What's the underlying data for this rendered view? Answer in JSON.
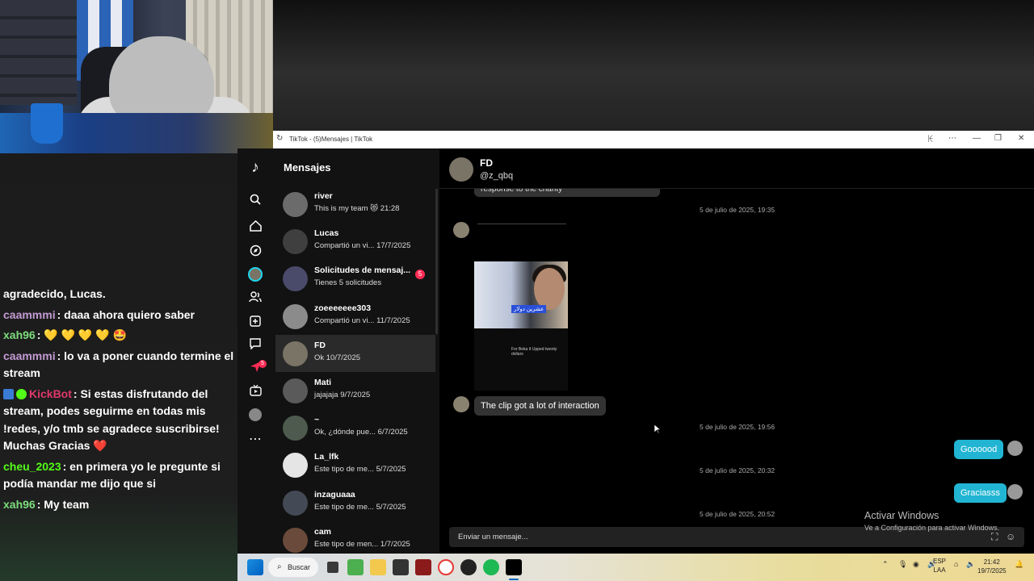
{
  "window": {
    "title": "TikTok - (5)Mensajes | TikTok",
    "right_glyph": "ꀘ"
  },
  "sidebar": {
    "header": "Mensajes",
    "notification_count": "5"
  },
  "conversations": [
    {
      "name": "river",
      "preview": "This is my team 😻 21:28",
      "avatar_color": "#6b6b6b"
    },
    {
      "name": "Lucas",
      "preview": "Compartió un vi... 17/7/2025",
      "avatar_color": "#3f3f3f"
    },
    {
      "name": "Solicitudes de mensaj...",
      "preview": "Tienes 5 solicitudes",
      "avatar_color": "#4a4a6a",
      "badge": "5"
    },
    {
      "name": "zoeeeeeee303",
      "preview": "Compartió un vi... 11/7/2025",
      "avatar_color": "#8b8b8b"
    },
    {
      "name": "FD",
      "preview": "Ok 10/7/2025",
      "avatar_color": "#7a7466",
      "selected": true
    },
    {
      "name": "Mati",
      "preview": "jajajaja 9/7/2025",
      "avatar_color": "#5a5a5a"
    },
    {
      "name": "~",
      "preview": "Ok, ¿dónde pue... 6/7/2025",
      "avatar_color": "#4d5a4d"
    },
    {
      "name": "La_lfk",
      "preview": "Este tipo de me... 5/7/2025",
      "avatar_color": "#e5e5e5"
    },
    {
      "name": "inzaguaaa",
      "preview": "Este tipo de me... 5/7/2025",
      "avatar_color": "#444a55"
    },
    {
      "name": "cam",
      "preview": "Este tipo de men... 1/7/2025",
      "avatar_color": "#6a4a3a"
    }
  ],
  "chat": {
    "contact_name": "FD",
    "contact_handle": "@z_qbq",
    "top_bubble": "response to the charity",
    "timestamps": [
      "5 de julio de 2025, 19:35",
      "5 de julio de 2025, 19:56",
      "5 de julio de 2025, 20:32",
      "5 de julio de 2025, 20:52"
    ],
    "clip_label": "عشرين دولار",
    "clip_caption": "For Beka It Upped twenty dollars",
    "incoming_message": "The clip got a lot of interaction",
    "outgoing_1": "Goooood",
    "outgoing_2": "Graciasss",
    "composer_placeholder": "Enviar un mensaje..."
  },
  "activate_windows": {
    "title": "Activar Windows",
    "subtitle": "Ve a Configuración para activar Windows."
  },
  "stream_chat": [
    {
      "user": "",
      "text": "agradecido, Lucas.",
      "user_color": "#ffffff"
    },
    {
      "user": "caammmi",
      "text": ": daaa ahora quiero saber",
      "user_color": "#c39bd3"
    },
    {
      "user": "xah96",
      "text": ": 💛 💛 💛 💛 🤩",
      "user_color": "#7ddc7d"
    },
    {
      "user": "caammmi",
      "text": ": lo va a poner cuando termine el stream",
      "user_color": "#c39bd3"
    },
    {
      "user": "KickBot",
      "text": ": Si estas disfrutando del stream, podes seguirme en todas mis !redes, y/o tmb se agradece suscribirse! Muchas Gracias ❤️",
      "user_color": "#e0386b",
      "badges": true
    },
    {
      "user": "cheu_2023",
      "text": ": en primera yo le pregunte si podía mandar me dijo que si",
      "user_color": "#53fc18"
    },
    {
      "user": "xah96",
      "text": ": My team",
      "user_color": "#7ddc7d"
    }
  ],
  "taskbar": {
    "search_label": "Buscar",
    "lang_top": "ESP",
    "lang_bottom": "LAA",
    "time": "21:42",
    "date": "19/7/2025"
  }
}
